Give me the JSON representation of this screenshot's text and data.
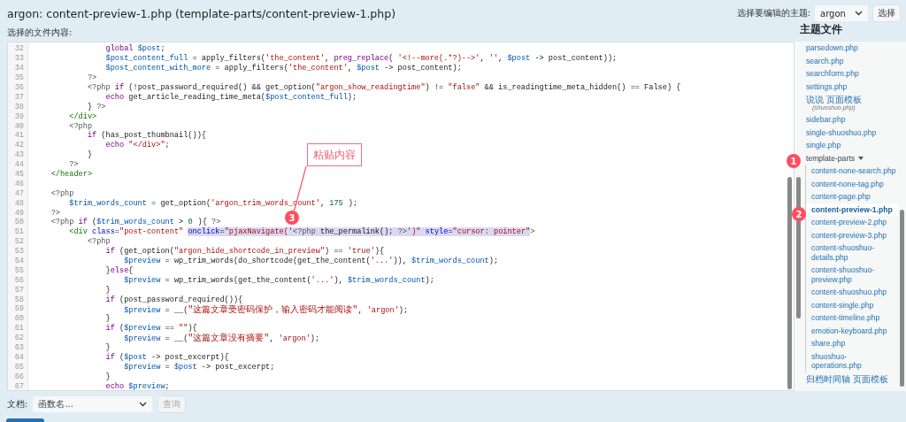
{
  "header": {
    "title": "argon: content-preview-1.php (template-parts/content-preview-1.php)",
    "theme_label": "选择要编辑的主题:",
    "theme_select": "argon",
    "select_button": "选择"
  },
  "content_label": "选择的文件内容:",
  "code_lines": [
    {
      "number": "32",
      "tokens": [
        {
          "kind": "kw",
          "text": "                global"
        },
        {
          "kind": "var",
          "text": " $post"
        },
        {
          "kind": "plain",
          "text": ";"
        }
      ]
    },
    {
      "number": "33",
      "tokens": [
        {
          "kind": "var",
          "text": "                $post_content_full"
        },
        {
          "kind": "plain",
          "text": " = apply_filters("
        },
        {
          "kind": "str",
          "text": "'the_content'"
        },
        {
          "kind": "plain",
          "text": ", "
        },
        {
          "kind": "kw",
          "text": "preg_replace"
        },
        {
          "kind": "plain",
          "text": "( "
        },
        {
          "kind": "str",
          "text": "'<!--more(.*?)-->'"
        },
        {
          "kind": "plain",
          "text": ", "
        },
        {
          "kind": "str",
          "text": "''"
        },
        {
          "kind": "plain",
          "text": ", "
        },
        {
          "kind": "var",
          "text": "$post"
        },
        {
          "kind": "plain",
          "text": " -> post_content));"
        }
      ]
    },
    {
      "number": "34",
      "tokens": [
        {
          "kind": "var",
          "text": "                $post_content_with_more"
        },
        {
          "kind": "plain",
          "text": " = apply_filters("
        },
        {
          "kind": "str",
          "text": "'the_content'"
        },
        {
          "kind": "plain",
          "text": ", "
        },
        {
          "kind": "var",
          "text": "$post"
        },
        {
          "kind": "plain",
          "text": " -> post_content);"
        }
      ]
    },
    {
      "number": "35",
      "tokens": [
        {
          "kind": "meta",
          "text": "            ?>"
        }
      ]
    },
    {
      "number": "36",
      "tokens": [
        {
          "kind": "meta",
          "text": "            <?php"
        },
        {
          "kind": "kw",
          "text": " if"
        },
        {
          "kind": "plain",
          "text": " (!post_password_required() && get_option("
        },
        {
          "kind": "str",
          "text": "\"argon_show_readingtime\""
        },
        {
          "kind": "plain",
          "text": ") != "
        },
        {
          "kind": "str",
          "text": "\"false\""
        },
        {
          "kind": "plain",
          "text": " && is_readingtime_meta_hidden() == False) {"
        }
      ]
    },
    {
      "number": "37",
      "tokens": [
        {
          "kind": "kw",
          "text": "                echo"
        },
        {
          "kind": "plain",
          "text": " get_article_reading_time_meta("
        },
        {
          "kind": "var",
          "text": "$post_content_full"
        },
        {
          "kind": "plain",
          "text": ");"
        }
      ]
    },
    {
      "number": "38",
      "tokens": [
        {
          "kind": "plain",
          "text": "            } "
        },
        {
          "kind": "meta",
          "text": "?>"
        }
      ]
    },
    {
      "number": "39",
      "tokens": [
        {
          "kind": "tag",
          "text": "        </div>"
        }
      ]
    },
    {
      "number": "40",
      "tokens": [
        {
          "kind": "meta",
          "text": "        <?php"
        }
      ]
    },
    {
      "number": "41",
      "tokens": [
        {
          "kind": "kw",
          "text": "            if"
        },
        {
          "kind": "plain",
          "text": " (has_post_thumbnail()){"
        }
      ]
    },
    {
      "number": "42",
      "tokens": [
        {
          "kind": "kw",
          "text": "                echo"
        },
        {
          "kind": "str",
          "text": " \"</div>\""
        },
        {
          "kind": "plain",
          "text": ";"
        }
      ]
    },
    {
      "number": "43",
      "tokens": [
        {
          "kind": "plain",
          "text": "            }"
        }
      ]
    },
    {
      "number": "44",
      "tokens": [
        {
          "kind": "meta",
          "text": "        ?>"
        }
      ]
    },
    {
      "number": "45",
      "tokens": [
        {
          "kind": "tag",
          "text": "    </header>"
        }
      ]
    },
    {
      "number": "46"
    },
    {
      "number": "47",
      "tokens": [
        {
          "kind": "meta",
          "text": "    <?php"
        }
      ]
    },
    {
      "number": "48",
      "tokens": [
        {
          "kind": "var",
          "text": "        $trim_words_count"
        },
        {
          "kind": "plain",
          "text": " = get_option("
        },
        {
          "kind": "str",
          "text": "'argon_trim_words_count'"
        },
        {
          "kind": "plain",
          "text": ", "
        },
        {
          "kind": "num",
          "text": "175"
        },
        {
          "kind": "plain",
          "text": ");"
        }
      ]
    },
    {
      "number": "49",
      "tokens": [
        {
          "kind": "meta",
          "text": "    ?>"
        }
      ]
    },
    {
      "number": "50",
      "tokens": [
        {
          "kind": "meta",
          "text": "    <?php"
        },
        {
          "kind": "kw",
          "text": " if"
        },
        {
          "kind": "plain",
          "text": " ("
        },
        {
          "kind": "var",
          "text": "$trim_words_count"
        },
        {
          "kind": "plain",
          "text": " > "
        },
        {
          "kind": "num",
          "text": "0"
        },
        {
          "kind": "plain",
          "text": "){ "
        },
        {
          "kind": "meta",
          "text": "?>"
        }
      ]
    },
    {
      "number": "51",
      "tokens": [
        {
          "kind": "tag",
          "text": "        <div"
        },
        {
          "kind": "attr",
          "text": " class"
        },
        {
          "kind": "plain",
          "text": "="
        },
        {
          "kind": "str",
          "text": "\"post-content\" "
        }
      ],
      "selection": [
        {
          "kind": "attr",
          "text": "onclick"
        },
        {
          "kind": "plain",
          "text": "="
        },
        {
          "kind": "str",
          "text": "\"pjaxNavigate('"
        },
        {
          "kind": "meta",
          "text": "<?php"
        },
        {
          "kind": "plain",
          "text": " the_permalink(); "
        },
        {
          "kind": "meta",
          "text": "?>"
        },
        {
          "kind": "str",
          "text": "')\""
        },
        {
          "kind": "attr",
          "text": " style"
        },
        {
          "kind": "plain",
          "text": "="
        },
        {
          "kind": "str",
          "text": "\"cursor: pointer\""
        }
      ],
      "after": [
        {
          "kind": "tag",
          "text": ">"
        }
      ]
    },
    {
      "number": "52",
      "tokens": [
        {
          "kind": "meta",
          "text": "            <?php"
        }
      ]
    },
    {
      "number": "53",
      "tokens": [
        {
          "kind": "kw",
          "text": "                if"
        },
        {
          "kind": "plain",
          "text": " (get_option("
        },
        {
          "kind": "str",
          "text": "\"argon_hide_shortcode_in_preview\""
        },
        {
          "kind": "plain",
          "text": ") == "
        },
        {
          "kind": "str",
          "text": "'true'"
        },
        {
          "kind": "plain",
          "text": "){"
        }
      ]
    },
    {
      "number": "54",
      "tokens": [
        {
          "kind": "var",
          "text": "                    $preview"
        },
        {
          "kind": "plain",
          "text": " = wp_trim_words(do_shortcode(get_the_content("
        },
        {
          "kind": "str",
          "text": "'...'"
        },
        {
          "kind": "plain",
          "text": ")), "
        },
        {
          "kind": "var",
          "text": "$trim_words_count"
        },
        {
          "kind": "plain",
          "text": ");"
        }
      ]
    },
    {
      "number": "55",
      "tokens": [
        {
          "kind": "plain",
          "text": "                }"
        },
        {
          "kind": "kw",
          "text": "else"
        },
        {
          "kind": "plain",
          "text": "{"
        }
      ]
    },
    {
      "number": "56",
      "tokens": [
        {
          "kind": "var",
          "text": "                    $preview"
        },
        {
          "kind": "plain",
          "text": " = wp_trim_words(get_the_content("
        },
        {
          "kind": "str",
          "text": "'...'"
        },
        {
          "kind": "plain",
          "text": "), "
        },
        {
          "kind": "var",
          "text": "$trim_words_count"
        },
        {
          "kind": "plain",
          "text": ");"
        }
      ]
    },
    {
      "number": "57",
      "tokens": [
        {
          "kind": "plain",
          "text": "                }"
        }
      ]
    },
    {
      "number": "58",
      "tokens": [
        {
          "kind": "kw",
          "text": "                if"
        },
        {
          "kind": "plain",
          "text": " (post_password_required()){"
        }
      ]
    },
    {
      "number": "59",
      "tokens": [
        {
          "kind": "var",
          "text": "                    $preview"
        },
        {
          "kind": "plain",
          "text": " = __("
        },
        {
          "kind": "str",
          "text": "\"这篇文章受密码保护，输入密码才能阅读\""
        },
        {
          "kind": "plain",
          "text": ", "
        },
        {
          "kind": "str",
          "text": "'argon'"
        },
        {
          "kind": "plain",
          "text": ");"
        }
      ]
    },
    {
      "number": "60",
      "tokens": [
        {
          "kind": "plain",
          "text": "                }"
        }
      ]
    },
    {
      "number": "61",
      "tokens": [
        {
          "kind": "kw",
          "text": "                if"
        },
        {
          "kind": "plain",
          "text": " ("
        },
        {
          "kind": "var",
          "text": "$preview"
        },
        {
          "kind": "plain",
          "text": " == "
        },
        {
          "kind": "str",
          "text": "\"\""
        },
        {
          "kind": "plain",
          "text": "){"
        }
      ]
    },
    {
      "number": "62",
      "tokens": [
        {
          "kind": "var",
          "text": "                    $preview"
        },
        {
          "kind": "plain",
          "text": " = __("
        },
        {
          "kind": "str",
          "text": "\"这篇文章没有摘要\""
        },
        {
          "kind": "plain",
          "text": ", "
        },
        {
          "kind": "str",
          "text": "'argon'"
        },
        {
          "kind": "plain",
          "text": ");"
        }
      ]
    },
    {
      "number": "63",
      "tokens": [
        {
          "kind": "plain",
          "text": "                }"
        }
      ]
    },
    {
      "number": "64",
      "tokens": [
        {
          "kind": "kw",
          "text": "                if"
        },
        {
          "kind": "plain",
          "text": " ("
        },
        {
          "kind": "var",
          "text": "$post"
        },
        {
          "kind": "plain",
          "text": " -> post_excerpt){"
        }
      ]
    },
    {
      "number": "65",
      "tokens": [
        {
          "kind": "var",
          "text": "                    $preview"
        },
        {
          "kind": "plain",
          "text": " = "
        },
        {
          "kind": "var",
          "text": "$post"
        },
        {
          "kind": "plain",
          "text": " -> post_excerpt;"
        }
      ]
    },
    {
      "number": "66",
      "tokens": [
        {
          "kind": "plain",
          "text": "                }"
        }
      ]
    },
    {
      "number": "67",
      "tokens": [
        {
          "kind": "kw",
          "text": "                echo"
        },
        {
          "kind": "var",
          "text": " $preview"
        },
        {
          "kind": "plain",
          "text": ";"
        }
      ]
    }
  ],
  "sidebar": {
    "heading": "主题文件",
    "items": [
      {
        "label": "parsedown.php",
        "selected": false
      },
      {
        "label": "search.php",
        "selected": false
      },
      {
        "label": "searchform.php",
        "selected": false
      },
      {
        "label": "settings.php",
        "selected": false
      },
      {
        "label": "说说 页面模板",
        "note": "(shuoshuo.php)",
        "selected": false
      },
      {
        "label": "sidebar.php",
        "selected": false
      },
      {
        "label": "single-shuoshuo.php",
        "selected": false
      },
      {
        "label": "single.php",
        "selected": false
      },
      {
        "label": "template-parts",
        "selected": false,
        "expanded": true,
        "children": [
          {
            "label": "content-none-search.php",
            "selected": false
          },
          {
            "label": "content-none-tag.php",
            "selected": false
          },
          {
            "label": "content-page.php",
            "selected": false
          },
          {
            "label": "content-preview-1.php",
            "selected": true
          },
          {
            "label": "content-preview-2.php",
            "selected": false
          },
          {
            "label": "content-preview-3.php",
            "selected": false
          },
          {
            "label": "content-shuoshuo-details.php",
            "selected": false
          },
          {
            "label": "content-shuoshuo-preview.php",
            "selected": false
          },
          {
            "label": "content-shuoshuo.php",
            "selected": false
          },
          {
            "label": "content-single.php",
            "selected": false
          },
          {
            "label": "content-timeline.php",
            "selected": false
          },
          {
            "label": "emotion-keyboard.php",
            "selected": false
          },
          {
            "label": "share.php",
            "selected": false
          },
          {
            "label": "shuoshuo-operations.php",
            "selected": false
          }
        ]
      },
      {
        "label": "归档时间轴 页面模板",
        "selected": false
      }
    ]
  },
  "footer": {
    "docs_label": "文档:",
    "function_select": {
      "placeholder": "函数名..."
    },
    "lookup_button": {
      "label": "查询",
      "disabled": true
    }
  },
  "annotations": {
    "callout": "粘贴内容",
    "badges": [
      "1",
      "2",
      "3"
    ]
  }
}
